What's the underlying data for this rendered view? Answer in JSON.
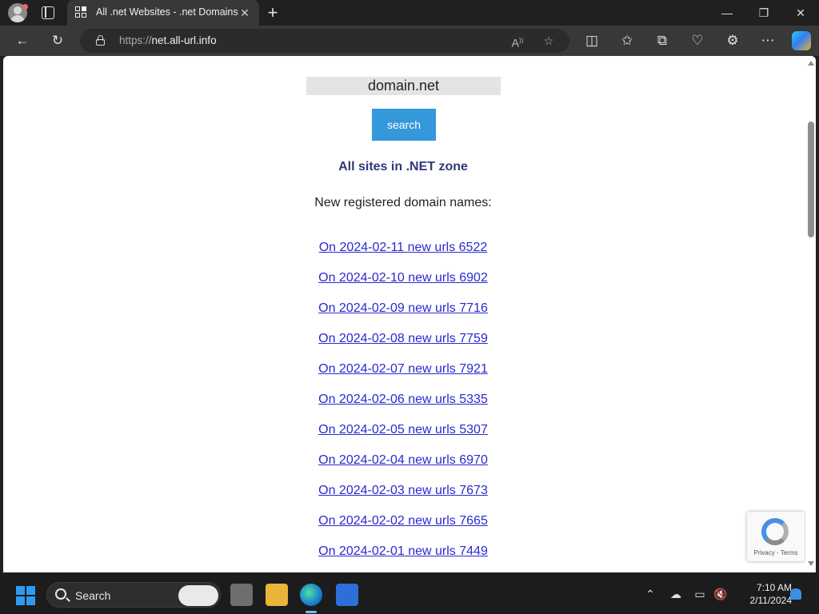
{
  "browser": {
    "tab_title": "All .net Websites - .net Domains",
    "url_protocol": "https://",
    "url_host": "net.all-url.info",
    "tab_close_glyph": "✕",
    "new_tab_glyph": "+",
    "minimize_glyph": "—",
    "restore_glyph": "❐",
    "close_glyph": "✕"
  },
  "page": {
    "search_value": "domain.net",
    "search_button": "search",
    "heading": "All sites in .NET zone",
    "subheading": "New registered domain names:",
    "links": [
      "On 2024-02-11 new urls 6522",
      "On 2024-02-10 new urls 6902",
      "On 2024-02-09 new urls 7716",
      "On 2024-02-08 new urls 7759",
      "On 2024-02-07 new urls 7921",
      "On 2024-02-06 new urls 5335",
      "On 2024-02-05 new urls 5307",
      "On 2024-02-04 new urls 6970",
      "On 2024-02-03 new urls 7673",
      "On 2024-02-02 new urls 7665",
      "On 2024-02-01 new urls 7449"
    ],
    "recaptcha_text": "Privacy - Terms"
  },
  "taskbar": {
    "search_label": "Search",
    "time": "7:10 AM",
    "date": "2/11/2024"
  },
  "colors": {
    "button_blue": "#3498db",
    "heading_navy": "#2e3a7a",
    "link_blue": "#2a2ad0"
  }
}
